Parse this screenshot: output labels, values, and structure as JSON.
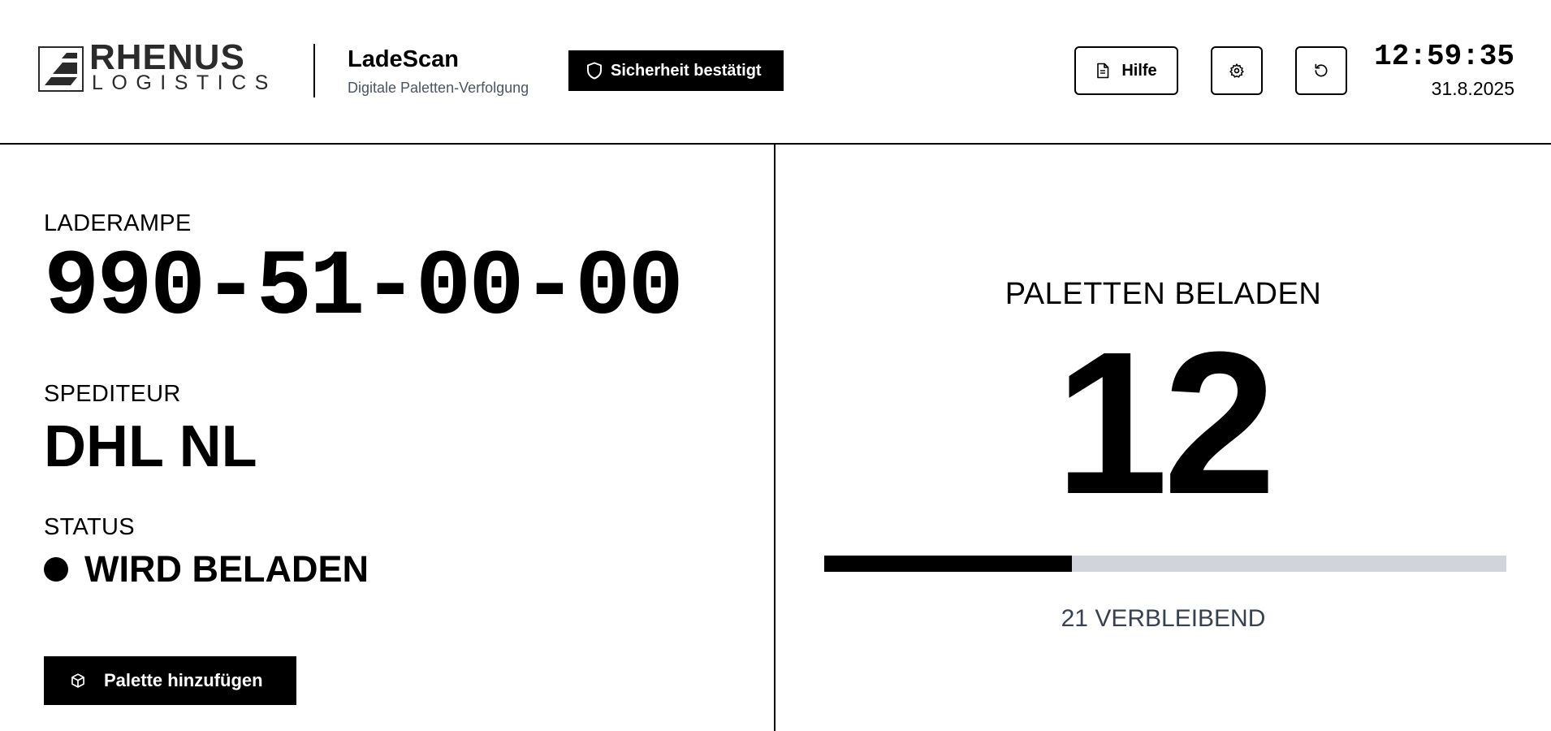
{
  "brand": {
    "logo_text_top": "RHENUS",
    "logo_text_bottom": "LOGISTICS"
  },
  "app": {
    "title": "LadeScan",
    "subtitle": "Digitale Paletten-Verfolgung"
  },
  "safety_badge": {
    "label": "Sicherheit bestätigt",
    "icon": "shield-icon"
  },
  "toolbar": {
    "help_label": "Hilfe",
    "help_icon": "document-icon",
    "settings_icon": "gear-icon",
    "reset_icon": "rotate-ccw-icon"
  },
  "clock": {
    "time": "12:59:35",
    "date": "31.8.2025"
  },
  "left_panel": {
    "ramp_label": "LADERAMPE",
    "ramp_value": "990-51-00-00",
    "carrier_label": "SPEDITEUR",
    "carrier_value": "DHL NL",
    "status_label": "STATUS",
    "status_value": "WIRD BELADEN",
    "add_button_label": "Palette hinzufügen",
    "add_button_icon": "box-icon"
  },
  "right_panel": {
    "pallets_label": "PALETTEN BELADEN",
    "pallets_count": "12",
    "remaining_text": "21 VERBLEIBEND",
    "progress_fraction": 0.3636
  },
  "colors": {
    "primary": "#000000",
    "progress_track": "#d1d5db",
    "muted_text": "#4b5563"
  }
}
